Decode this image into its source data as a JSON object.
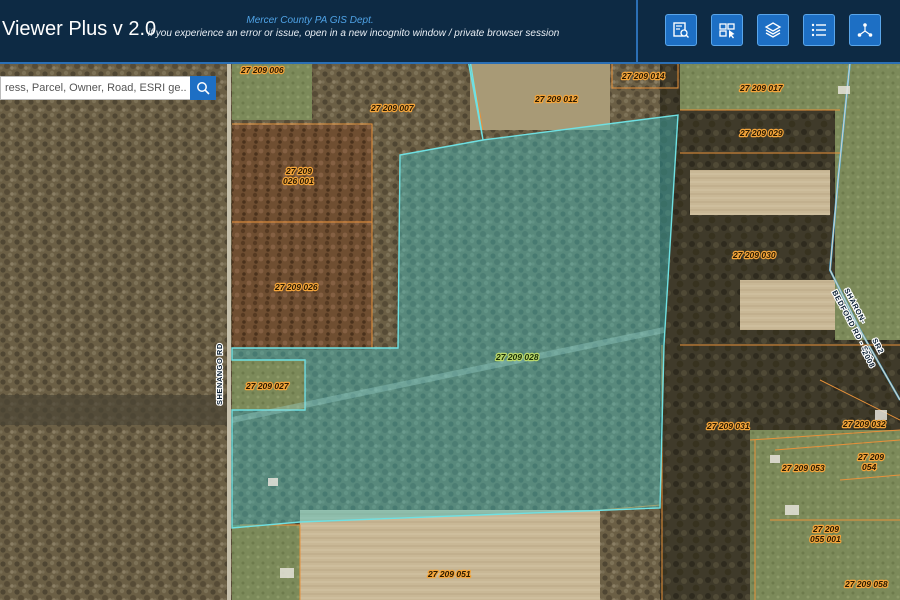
{
  "header": {
    "title": "Viewer Plus v 2.0",
    "department": "Mercer County PA GIS Dept.",
    "notice": "if you experience an error or issue, open in a new incognito window / private browser session"
  },
  "toolbar": {
    "buttons": [
      {
        "name": "query-tool-button",
        "icon": "query-icon"
      },
      {
        "name": "identify-tool-button",
        "icon": "identify-icon"
      },
      {
        "name": "layers-button",
        "icon": "layers-icon"
      },
      {
        "name": "legend-button",
        "icon": "list-icon"
      },
      {
        "name": "share-button",
        "icon": "share-icon"
      }
    ]
  },
  "search": {
    "placeholder": "ress, Parcel, Owner, Road, ESRI ge...",
    "button_icon": "search-icon"
  },
  "map": {
    "selected_parcel": "27 209 028",
    "selected_color": "#3ec4c8",
    "parcel_line_color": "#e8913a",
    "parcels": [
      "27 209 006",
      "27 209 007",
      "27 209 012",
      "27 209 014",
      "27 209 017",
      "27 209 029",
      "27 209",
      "026 001",
      "27 209 026",
      "27 209 030",
      "27 209 028",
      "27 209 027",
      "27 209 031",
      "27 209 032",
      "27 209",
      "054",
      "27 209 053",
      "27 209",
      "055 001",
      "27 209 051",
      "27 209 058"
    ],
    "roads": [
      "SHENANGO RD",
      "SHARON-",
      "BEDFORD RD - SR2",
      "SR2",
      "2008"
    ]
  }
}
